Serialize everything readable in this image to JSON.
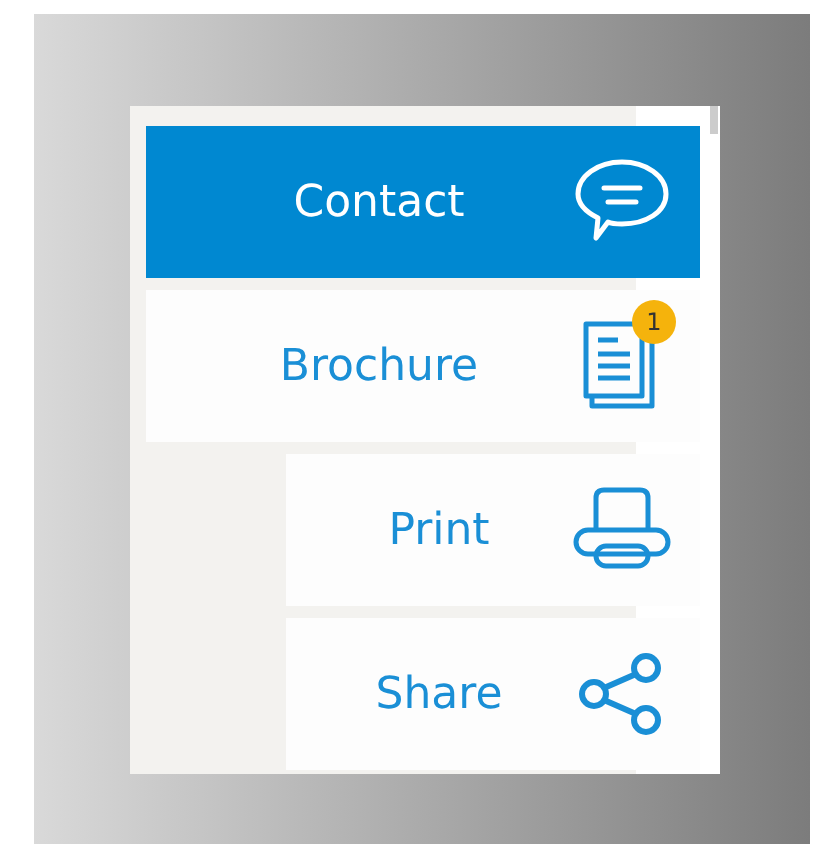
{
  "menu": [
    {
      "label": "Contact",
      "selected": true,
      "indented": false
    },
    {
      "label": "Brochure",
      "selected": false,
      "indented": false,
      "badge": "1"
    },
    {
      "label": "Print",
      "selected": false,
      "indented": true
    },
    {
      "label": "Share",
      "selected": false,
      "indented": true
    }
  ]
}
